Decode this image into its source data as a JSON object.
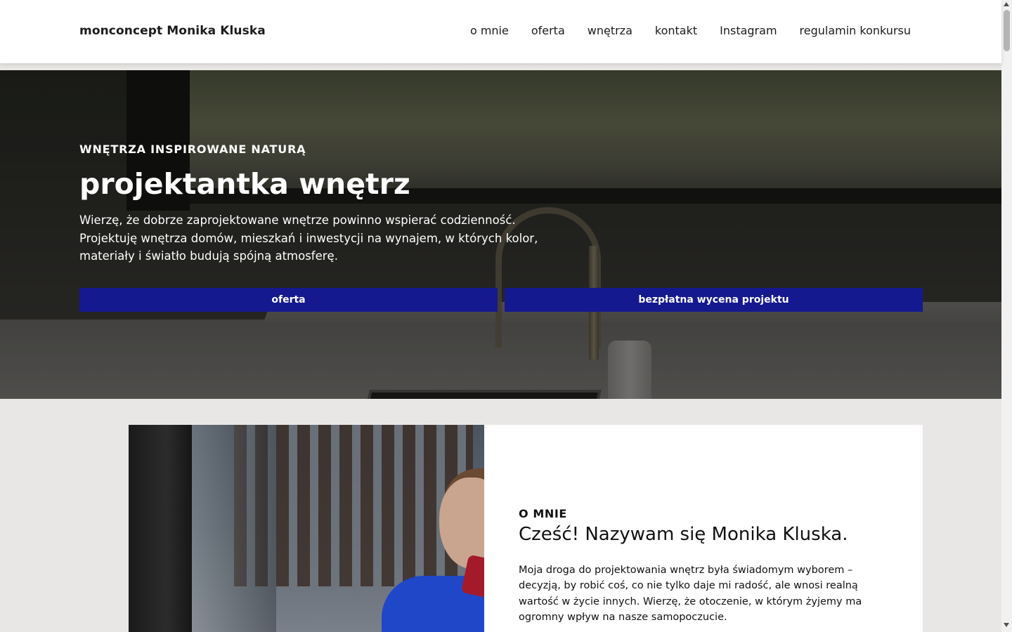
{
  "header": {
    "brand": "monconcept Monika Kluska",
    "nav": [
      {
        "label": "o mnie"
      },
      {
        "label": "oferta"
      },
      {
        "label": "wnętrza"
      },
      {
        "label": "kontakt"
      },
      {
        "label": "Instagram"
      },
      {
        "label": "regulamin konkursu"
      }
    ]
  },
  "hero": {
    "eyebrow": "WNĘTRZA INSPIROWANE NATURĄ",
    "title": "projektantka wnętrz",
    "description": "Wierzę, że dobrze zaprojektowane wnętrze powinno wspierać codzienność. Projektuję wnętrza domów, mieszkań i inwestycji na wynajem, w których kolor, materiały i światło budują spójną atmosferę.",
    "buttons": {
      "offer": "oferta",
      "quote": "bezpłatna wycena projektu"
    }
  },
  "about": {
    "eyebrow": "O MNIE",
    "title": "Cześć! Nazywam się Monika Kluska.",
    "text": "Moja droga do projektowania wnętrz była świadomym wyborem – decyzją, by robić coś, co nie tylko daje mi radość, ale wnosi realną wartość w życie innych. Wierzę, że otoczenie, w którym żyjemy ma ogromny wpływ na nasze samopoczucie."
  },
  "colors": {
    "button_bg": "#15198f",
    "page_bg": "#e9e7e5",
    "card_bg": "#ffffff"
  }
}
